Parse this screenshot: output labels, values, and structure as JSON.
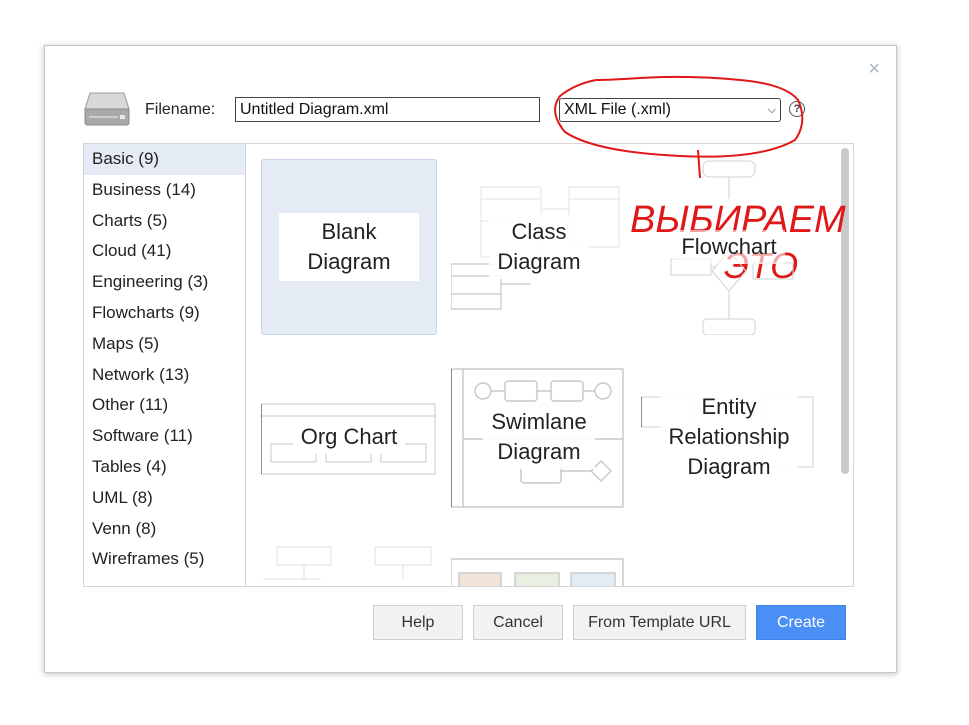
{
  "dialog": {
    "filename_label": "Filename:",
    "filename_value": "Untitled Diagram.xml",
    "format_selected": "XML File (.xml)",
    "help_glyph": "?",
    "close_glyph": "×"
  },
  "categories": [
    {
      "label": "Basic (9)",
      "selected": true
    },
    {
      "label": "Business (14)"
    },
    {
      "label": "Charts (5)"
    },
    {
      "label": "Cloud (41)"
    },
    {
      "label": "Engineering (3)"
    },
    {
      "label": "Flowcharts (9)"
    },
    {
      "label": "Maps (5)"
    },
    {
      "label": "Network (13)"
    },
    {
      "label": "Other (11)"
    },
    {
      "label": "Software (11)"
    },
    {
      "label": "Tables (4)"
    },
    {
      "label": "UML (8)"
    },
    {
      "label": "Venn (8)"
    },
    {
      "label": "Wireframes (5)"
    }
  ],
  "templates": {
    "blank": "Blank\nDiagram",
    "class": "Class\nDiagram",
    "flowchart": "Flowchart",
    "org": "Org Chart",
    "swimlane": "Swimlane\nDiagram",
    "er": "Entity\nRelationship\nDiagram"
  },
  "buttons": {
    "help": "Help",
    "cancel": "Cancel",
    "template_url": "From Template URL",
    "create": "Create"
  },
  "annotation": {
    "line1": "ВЫБИРАЕМ",
    "line2": "ЭТО",
    "color": "#e01818"
  },
  "colors": {
    "selection": "#e4ebf5",
    "primary_button": "#4b8ef5"
  }
}
